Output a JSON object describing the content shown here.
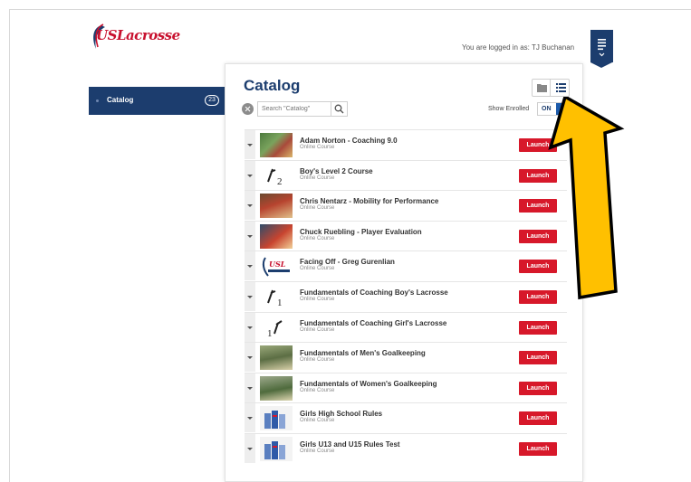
{
  "header": {
    "logo_text": "USLacrosse",
    "login_text": "You are logged in as: TJ Buchanan"
  },
  "colors": {
    "brand_navy": "#1c3d6e",
    "launch_red": "#d7182a",
    "arrow_yellow": "#ffc000"
  },
  "sidebar": {
    "items": [
      {
        "label": "Catalog",
        "count": "23"
      }
    ]
  },
  "catalog": {
    "title": "Catalog",
    "search_placeholder": "Search \"Catalog\"",
    "show_enrolled_label": "Show Enrolled",
    "toggle_label": "ON",
    "view_icons": [
      "folder-icon",
      "list-icon"
    ],
    "courses": [
      {
        "name": "Adam Norton - Coaching 9.0",
        "type": "Online Course",
        "action": "Launch",
        "thumb": "photo"
      },
      {
        "name": "Boy's Level 2 Course",
        "type": "Online Course",
        "action": "Launch",
        "thumb": "level2"
      },
      {
        "name": "Chris Nentarz - Mobility for Performance",
        "type": "Online Course",
        "action": "Launch",
        "thumb": "photo"
      },
      {
        "name": "Chuck Ruebling - Player Evaluation",
        "type": "Online Course",
        "action": "Launch",
        "thumb": "photo"
      },
      {
        "name": "Facing Off - Greg Gurenlian",
        "type": "Online Course",
        "action": "Launch",
        "thumb": "logo"
      },
      {
        "name": "Fundamentals of Coaching Boy's Lacrosse",
        "type": "Online Course",
        "action": "Launch",
        "thumb": "level1"
      },
      {
        "name": "Fundamentals of Coaching Girl's Lacrosse",
        "type": "Online Course",
        "action": "Launch",
        "thumb": "level1"
      },
      {
        "name": "Fundamentals of Men's Goalkeeping",
        "type": "Online Course",
        "action": "Launch",
        "thumb": "photo"
      },
      {
        "name": "Fundamentals of Women's Goalkeeping",
        "type": "Online Course",
        "action": "Launch",
        "thumb": "photo"
      },
      {
        "name": "Girls High School Rules",
        "type": "Online Course",
        "action": "Launch",
        "thumb": "books"
      },
      {
        "name": "Girls U13 and U15 Rules Test",
        "type": "Online Course",
        "action": "Launch",
        "thumb": "books"
      }
    ]
  }
}
